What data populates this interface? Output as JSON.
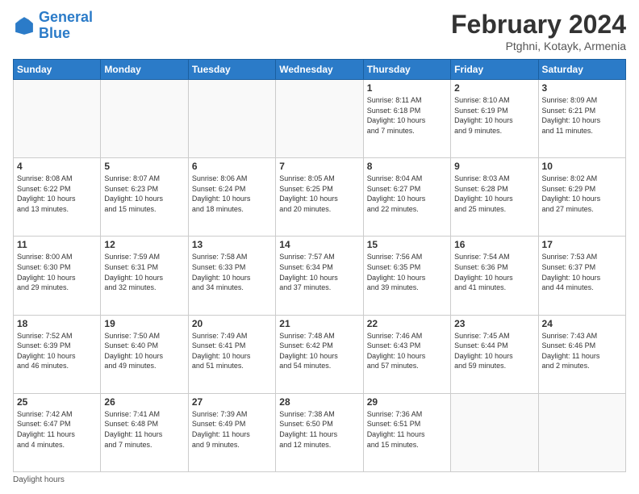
{
  "header": {
    "logo_line1": "General",
    "logo_line2": "Blue",
    "month_title": "February 2024",
    "location": "Ptghni, Kotayk, Armenia"
  },
  "footer": {
    "daylight_label": "Daylight hours"
  },
  "weekdays": [
    "Sunday",
    "Monday",
    "Tuesday",
    "Wednesday",
    "Thursday",
    "Friday",
    "Saturday"
  ],
  "weeks": [
    [
      {
        "day": "",
        "info": ""
      },
      {
        "day": "",
        "info": ""
      },
      {
        "day": "",
        "info": ""
      },
      {
        "day": "",
        "info": ""
      },
      {
        "day": "1",
        "info": "Sunrise: 8:11 AM\nSunset: 6:18 PM\nDaylight: 10 hours\nand 7 minutes."
      },
      {
        "day": "2",
        "info": "Sunrise: 8:10 AM\nSunset: 6:19 PM\nDaylight: 10 hours\nand 9 minutes."
      },
      {
        "day": "3",
        "info": "Sunrise: 8:09 AM\nSunset: 6:21 PM\nDaylight: 10 hours\nand 11 minutes."
      }
    ],
    [
      {
        "day": "4",
        "info": "Sunrise: 8:08 AM\nSunset: 6:22 PM\nDaylight: 10 hours\nand 13 minutes."
      },
      {
        "day": "5",
        "info": "Sunrise: 8:07 AM\nSunset: 6:23 PM\nDaylight: 10 hours\nand 15 minutes."
      },
      {
        "day": "6",
        "info": "Sunrise: 8:06 AM\nSunset: 6:24 PM\nDaylight: 10 hours\nand 18 minutes."
      },
      {
        "day": "7",
        "info": "Sunrise: 8:05 AM\nSunset: 6:25 PM\nDaylight: 10 hours\nand 20 minutes."
      },
      {
        "day": "8",
        "info": "Sunrise: 8:04 AM\nSunset: 6:27 PM\nDaylight: 10 hours\nand 22 minutes."
      },
      {
        "day": "9",
        "info": "Sunrise: 8:03 AM\nSunset: 6:28 PM\nDaylight: 10 hours\nand 25 minutes."
      },
      {
        "day": "10",
        "info": "Sunrise: 8:02 AM\nSunset: 6:29 PM\nDaylight: 10 hours\nand 27 minutes."
      }
    ],
    [
      {
        "day": "11",
        "info": "Sunrise: 8:00 AM\nSunset: 6:30 PM\nDaylight: 10 hours\nand 29 minutes."
      },
      {
        "day": "12",
        "info": "Sunrise: 7:59 AM\nSunset: 6:31 PM\nDaylight: 10 hours\nand 32 minutes."
      },
      {
        "day": "13",
        "info": "Sunrise: 7:58 AM\nSunset: 6:33 PM\nDaylight: 10 hours\nand 34 minutes."
      },
      {
        "day": "14",
        "info": "Sunrise: 7:57 AM\nSunset: 6:34 PM\nDaylight: 10 hours\nand 37 minutes."
      },
      {
        "day": "15",
        "info": "Sunrise: 7:56 AM\nSunset: 6:35 PM\nDaylight: 10 hours\nand 39 minutes."
      },
      {
        "day": "16",
        "info": "Sunrise: 7:54 AM\nSunset: 6:36 PM\nDaylight: 10 hours\nand 41 minutes."
      },
      {
        "day": "17",
        "info": "Sunrise: 7:53 AM\nSunset: 6:37 PM\nDaylight: 10 hours\nand 44 minutes."
      }
    ],
    [
      {
        "day": "18",
        "info": "Sunrise: 7:52 AM\nSunset: 6:39 PM\nDaylight: 10 hours\nand 46 minutes."
      },
      {
        "day": "19",
        "info": "Sunrise: 7:50 AM\nSunset: 6:40 PM\nDaylight: 10 hours\nand 49 minutes."
      },
      {
        "day": "20",
        "info": "Sunrise: 7:49 AM\nSunset: 6:41 PM\nDaylight: 10 hours\nand 51 minutes."
      },
      {
        "day": "21",
        "info": "Sunrise: 7:48 AM\nSunset: 6:42 PM\nDaylight: 10 hours\nand 54 minutes."
      },
      {
        "day": "22",
        "info": "Sunrise: 7:46 AM\nSunset: 6:43 PM\nDaylight: 10 hours\nand 57 minutes."
      },
      {
        "day": "23",
        "info": "Sunrise: 7:45 AM\nSunset: 6:44 PM\nDaylight: 10 hours\nand 59 minutes."
      },
      {
        "day": "24",
        "info": "Sunrise: 7:43 AM\nSunset: 6:46 PM\nDaylight: 11 hours\nand 2 minutes."
      }
    ],
    [
      {
        "day": "25",
        "info": "Sunrise: 7:42 AM\nSunset: 6:47 PM\nDaylight: 11 hours\nand 4 minutes."
      },
      {
        "day": "26",
        "info": "Sunrise: 7:41 AM\nSunset: 6:48 PM\nDaylight: 11 hours\nand 7 minutes."
      },
      {
        "day": "27",
        "info": "Sunrise: 7:39 AM\nSunset: 6:49 PM\nDaylight: 11 hours\nand 9 minutes."
      },
      {
        "day": "28",
        "info": "Sunrise: 7:38 AM\nSunset: 6:50 PM\nDaylight: 11 hours\nand 12 minutes."
      },
      {
        "day": "29",
        "info": "Sunrise: 7:36 AM\nSunset: 6:51 PM\nDaylight: 11 hours\nand 15 minutes."
      },
      {
        "day": "",
        "info": ""
      },
      {
        "day": "",
        "info": ""
      }
    ]
  ]
}
